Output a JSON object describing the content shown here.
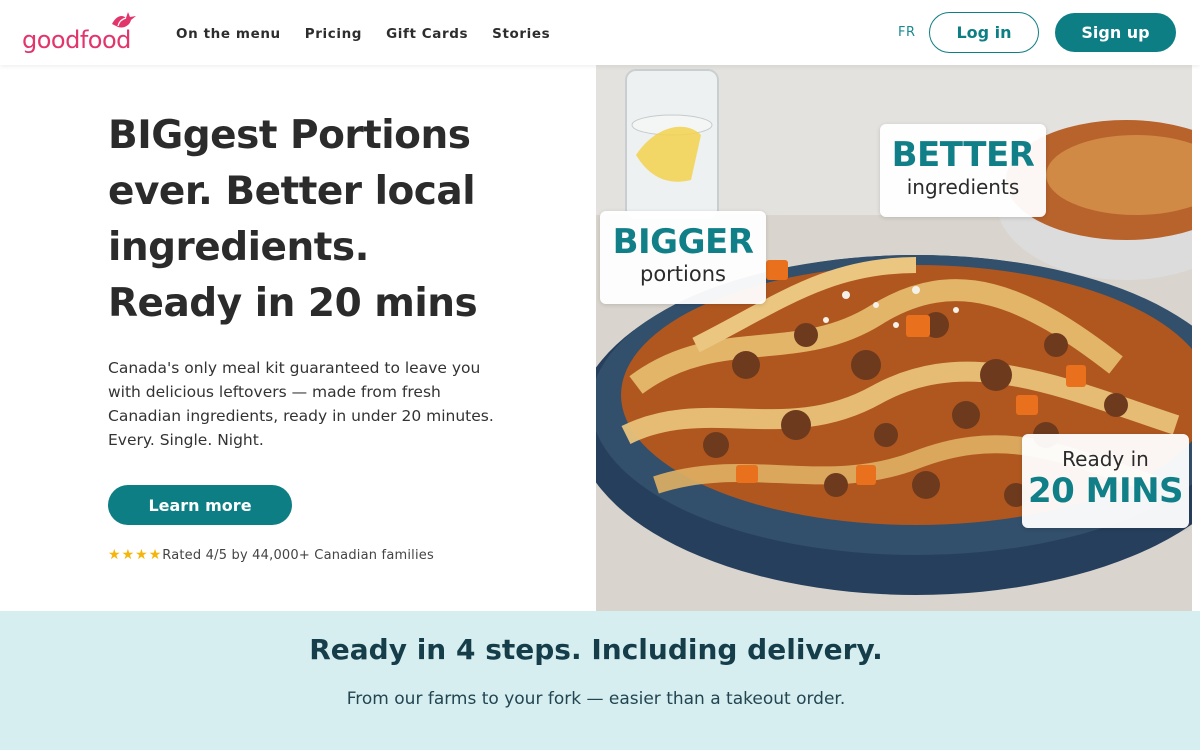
{
  "header": {
    "logo_text": "goodfood",
    "nav": [
      "On the menu",
      "Pricing",
      "Gift Cards",
      "Stories"
    ],
    "lang": "FR",
    "login_label": "Log in",
    "signup_label": "Sign up"
  },
  "hero": {
    "title_lines": [
      "BIGgest Portions",
      "ever. Better local",
      "ingredients.",
      "Ready in 20 mins"
    ],
    "subtitle": "Canada's only meal kit guaranteed to leave you with delicious leftovers — made from fresh Canadian ingredients, ready in under 20 minutes. Every. Single. Night.",
    "cta_label": "Learn more",
    "rating_stars": 4,
    "rating_text": "Rated 4/5 by 44,000+ Canadian families"
  },
  "hero_image": {
    "badges": {
      "bigger_big": "BIGGER",
      "bigger_small": "portions",
      "better_big": "BETTER",
      "better_small": "ingredients",
      "ready_small": "Ready in",
      "ready_big": "20 MINS"
    }
  },
  "steps": {
    "title": "Ready in 4 steps. Including delivery.",
    "subtitle": "From our farms to your fork — easier than a takeout order."
  },
  "colors": {
    "brand_pink": "#e2356c",
    "brand_teal": "#0e7e85",
    "steps_bg": "#d6eeef",
    "star": "#f5b50a"
  }
}
